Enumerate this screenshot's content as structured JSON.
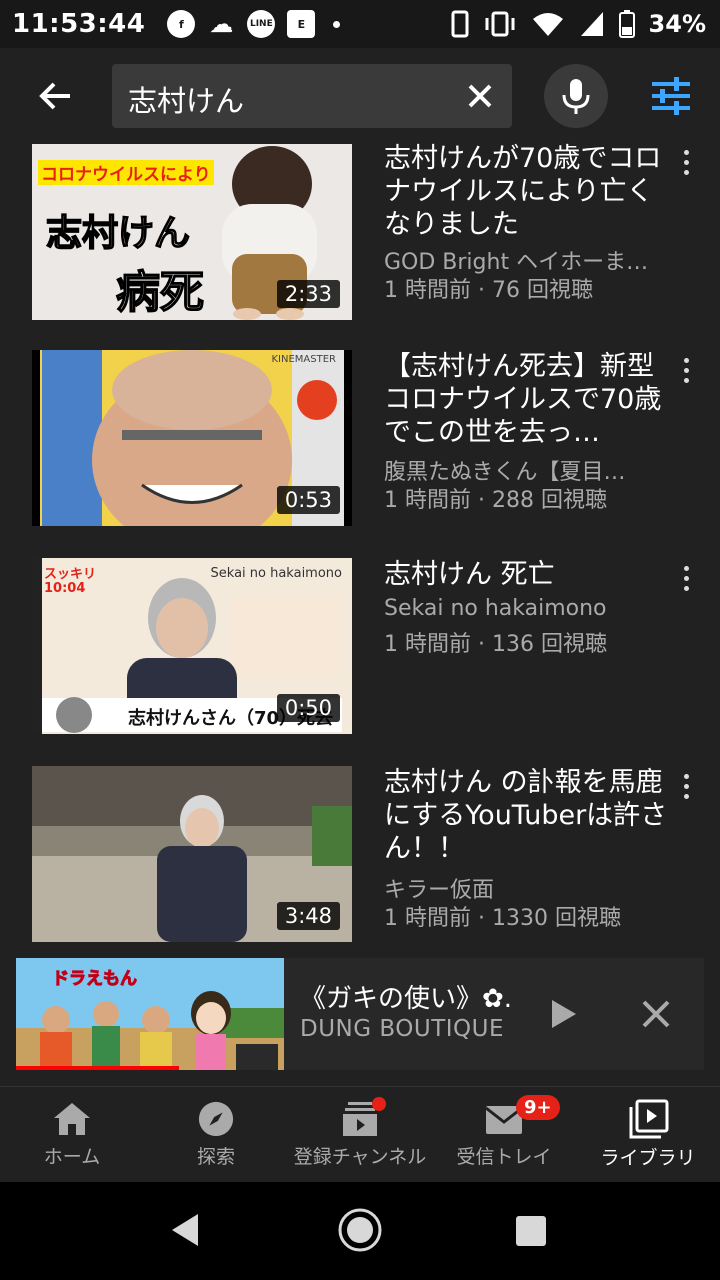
{
  "status_bar": {
    "time": "11:53:44",
    "apps": [
      "f",
      "☁",
      "LINE",
      "E"
    ],
    "battery": "34%"
  },
  "search": {
    "query": "志村けん"
  },
  "videos": [
    {
      "title": "志村けんが70歳でコロナウイルスにより亡くなりました",
      "channel": "GOD Bright ヘイホーま…",
      "meta": "1 時間前 · 76 回視聴",
      "duration": "2:33",
      "thumb_caption_top": "コロナウイルスにより",
      "thumb_caption_mid": "志村けん",
      "thumb_caption_bottom": "病死"
    },
    {
      "title": "【志村けん死去】新型コロナウイルスで70歳でこの世を去っ…",
      "channel": "腹黒たぬきくん【夏目…",
      "meta": "1 時間前 · 288 回視聴",
      "duration": "0:53",
      "thumb_watermark": "KINEMASTER"
    },
    {
      "title": "志村けん 死亡",
      "channel": "Sekai no hakaimono",
      "meta": "1 時間前 · 136 回視聴",
      "duration": "0:50",
      "thumb_corner": "スッキリ 10:04",
      "thumb_watermark": "Sekai no hakaimono",
      "thumb_subtitle": "志村けんさん（70）死去"
    },
    {
      "title": "志村けん の訃報を馬鹿にするYouTuberは許さん！！",
      "channel": "キラー仮面",
      "meta": "1 時間前 · 1330 回視聴",
      "duration": "3:48"
    }
  ],
  "mini_player": {
    "title": "《ガキの使い》✿..",
    "channel": "DUNG BOUTIQUE",
    "progress": 0.61,
    "thumb_logo": "ドラえもん"
  },
  "bottom_nav": [
    {
      "label": "ホーム",
      "icon": "home-icon"
    },
    {
      "label": "探索",
      "icon": "compass-icon"
    },
    {
      "label": "登録チャンネル",
      "icon": "subscriptions-icon"
    },
    {
      "label": "受信トレイ",
      "icon": "inbox-icon",
      "badge": "9+"
    },
    {
      "label": "ライブラリ",
      "icon": "library-icon",
      "active": true
    }
  ],
  "colors": {
    "background": "#212121",
    "accent_blue": "#3ea6ff",
    "badge_red": "#e62117",
    "progress_red": "#ff0000"
  }
}
